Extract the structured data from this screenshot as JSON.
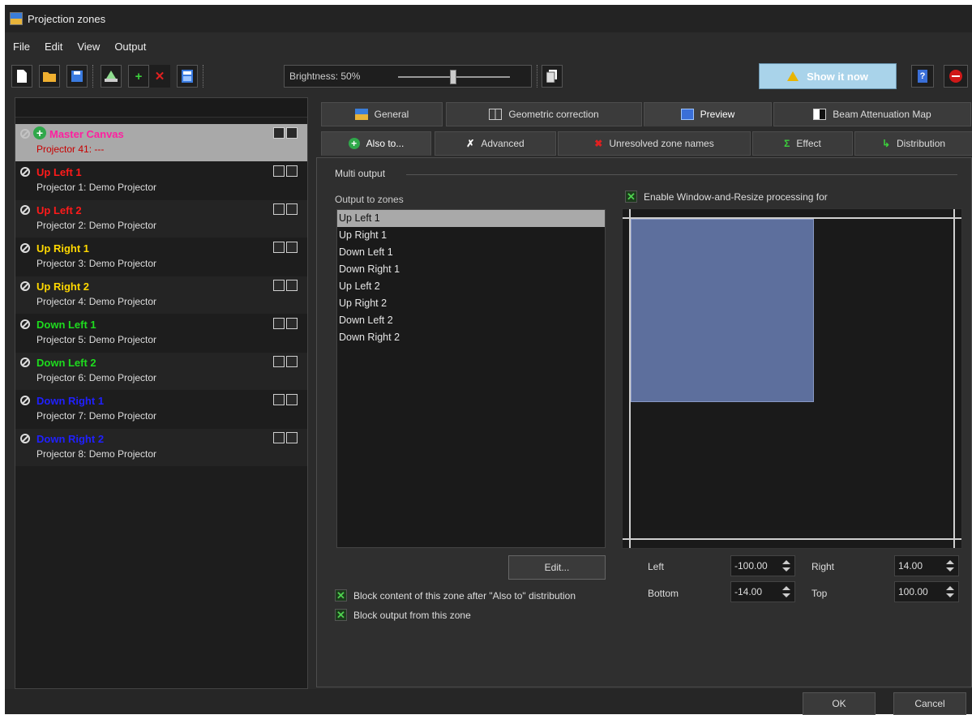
{
  "window": {
    "title": "Projection zones"
  },
  "menu": [
    "File",
    "Edit",
    "View",
    "Output"
  ],
  "toolbar": {
    "brightness_label": "Brightness: 50%",
    "brightness_value": 0.5,
    "show_label": "Show it now",
    "help_label": "?"
  },
  "zones": [
    {
      "name": "Master Canvas",
      "projector": "Projector 41: ---",
      "color": "#ff1fa0",
      "proj_color": "#c80000",
      "selected": true
    },
    {
      "name": "Up Left 1",
      "projector": "Projector 1: Demo Projector",
      "color": "#ff1a1a"
    },
    {
      "name": "Up Left 2",
      "projector": "Projector 2: Demo Projector",
      "color": "#ff1a1a"
    },
    {
      "name": "Up Right 1",
      "projector": "Projector 3: Demo Projector",
      "color": "#ffd800"
    },
    {
      "name": "Up Right 2",
      "projector": "Projector 4: Demo Projector",
      "color": "#ffd800"
    },
    {
      "name": "Down Left 1",
      "projector": "Projector 5: Demo Projector",
      "color": "#1edc1e"
    },
    {
      "name": "Down Left 2",
      "projector": "Projector 6: Demo Projector",
      "color": "#1edc1e"
    },
    {
      "name": "Down Right 1",
      "projector": "Projector 7: Demo Projector",
      "color": "#2020ff"
    },
    {
      "name": "Down Right 2",
      "projector": "Projector 8: Demo Projector",
      "color": "#2020ff"
    }
  ],
  "tabs_row1": [
    "General",
    "Geometric correction",
    "Preview",
    "Beam Attenuation Map"
  ],
  "tabs_row2": [
    "Also to...",
    "Advanced",
    "Unresolved zone names",
    "Effect",
    "Distribution"
  ],
  "also_to": {
    "group_label": "Multi output",
    "output_label": "Output to zones",
    "outputs": [
      "Up Left 1",
      "Up Right 1",
      "Down Left 1",
      "Down Right 1",
      "Up Left 2",
      "Up Right 2",
      "Down Left 2",
      "Down Right 2"
    ],
    "selected_output": "Up Left 1",
    "edit_label": "Edit...",
    "block_content_label": "Block content of this zone after \"Also to\" distribution",
    "block_output_label": "Block output from this zone",
    "enable_label": "Enable Window-and-Resize processing for",
    "fields": {
      "left_label": "Left",
      "left_value": "-100.00",
      "right_label": "Right",
      "right_value": "14.00",
      "bottom_label": "Bottom",
      "bottom_value": "-14.00",
      "top_label": "Top",
      "top_value": "100.00"
    }
  },
  "footer": {
    "ok": "OK",
    "cancel": "Cancel"
  }
}
